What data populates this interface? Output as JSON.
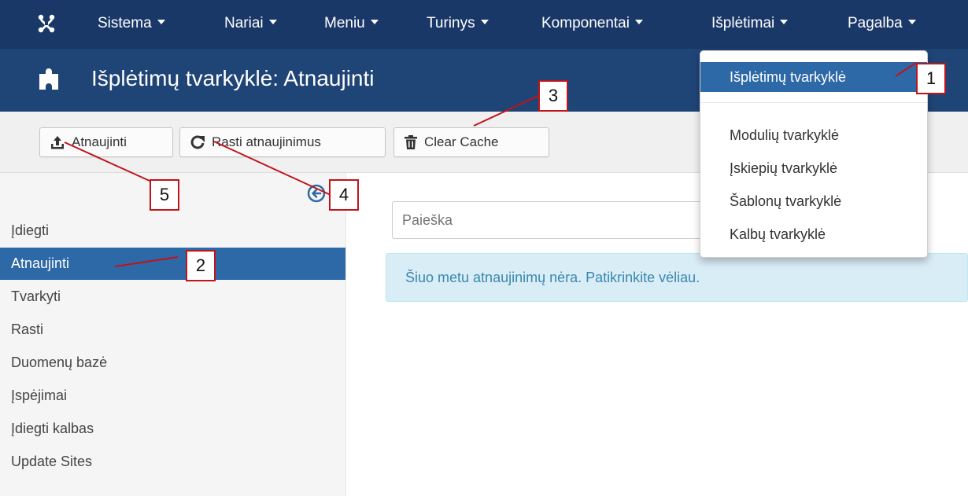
{
  "topnav": {
    "logo_icon": "joomla-logo-icon",
    "items": [
      {
        "label": "Sistema"
      },
      {
        "label": "Nariai"
      },
      {
        "label": "Meniu"
      },
      {
        "label": "Turinys"
      },
      {
        "label": "Komponentai"
      },
      {
        "label": "Išplėtimai"
      },
      {
        "label": "Pagalba"
      }
    ]
  },
  "page": {
    "title_icon": "puzzle-icon",
    "title": "Išplėtimų tvarkyklė: Atnaujinti"
  },
  "toolbar": {
    "update_label": "Atnaujinti",
    "find_updates_label": "Rasti atnaujinimus",
    "clear_cache_label": "Clear Cache"
  },
  "sidebar": {
    "collapse_icon": "arrow-left-circle-icon",
    "active_index": 1,
    "items": [
      {
        "label": "Įdiegti"
      },
      {
        "label": "Atnaujinti"
      },
      {
        "label": "Tvarkyti"
      },
      {
        "label": "Rasti"
      },
      {
        "label": "Duomenų bazė"
      },
      {
        "label": "Įspėjimai"
      },
      {
        "label": "Įdiegti kalbas"
      },
      {
        "label": "Update Sites"
      }
    ]
  },
  "main": {
    "search": {
      "placeholder": "Paieška"
    },
    "alert_text": "Šiuo metu atnaujinimų nėra. Patikrinkite vėliau."
  },
  "dropdown": {
    "items": [
      {
        "label": "Išplėtimų tvarkyklė"
      },
      {
        "label": "Modulių tvarkyklė"
      },
      {
        "label": "Įskiepių tvarkyklė"
      },
      {
        "label": "Šablonų tvarkyklė"
      },
      {
        "label": "Kalbų tvarkyklė"
      }
    ]
  },
  "callouts": [
    "1",
    "2",
    "3",
    "4",
    "5"
  ],
  "colors": {
    "nav_bg": "#1a3867",
    "title_bg": "#1f4476",
    "active_bg": "#2d69a7",
    "alert_bg": "#d9edf7",
    "callout_border": "#c0141a"
  }
}
